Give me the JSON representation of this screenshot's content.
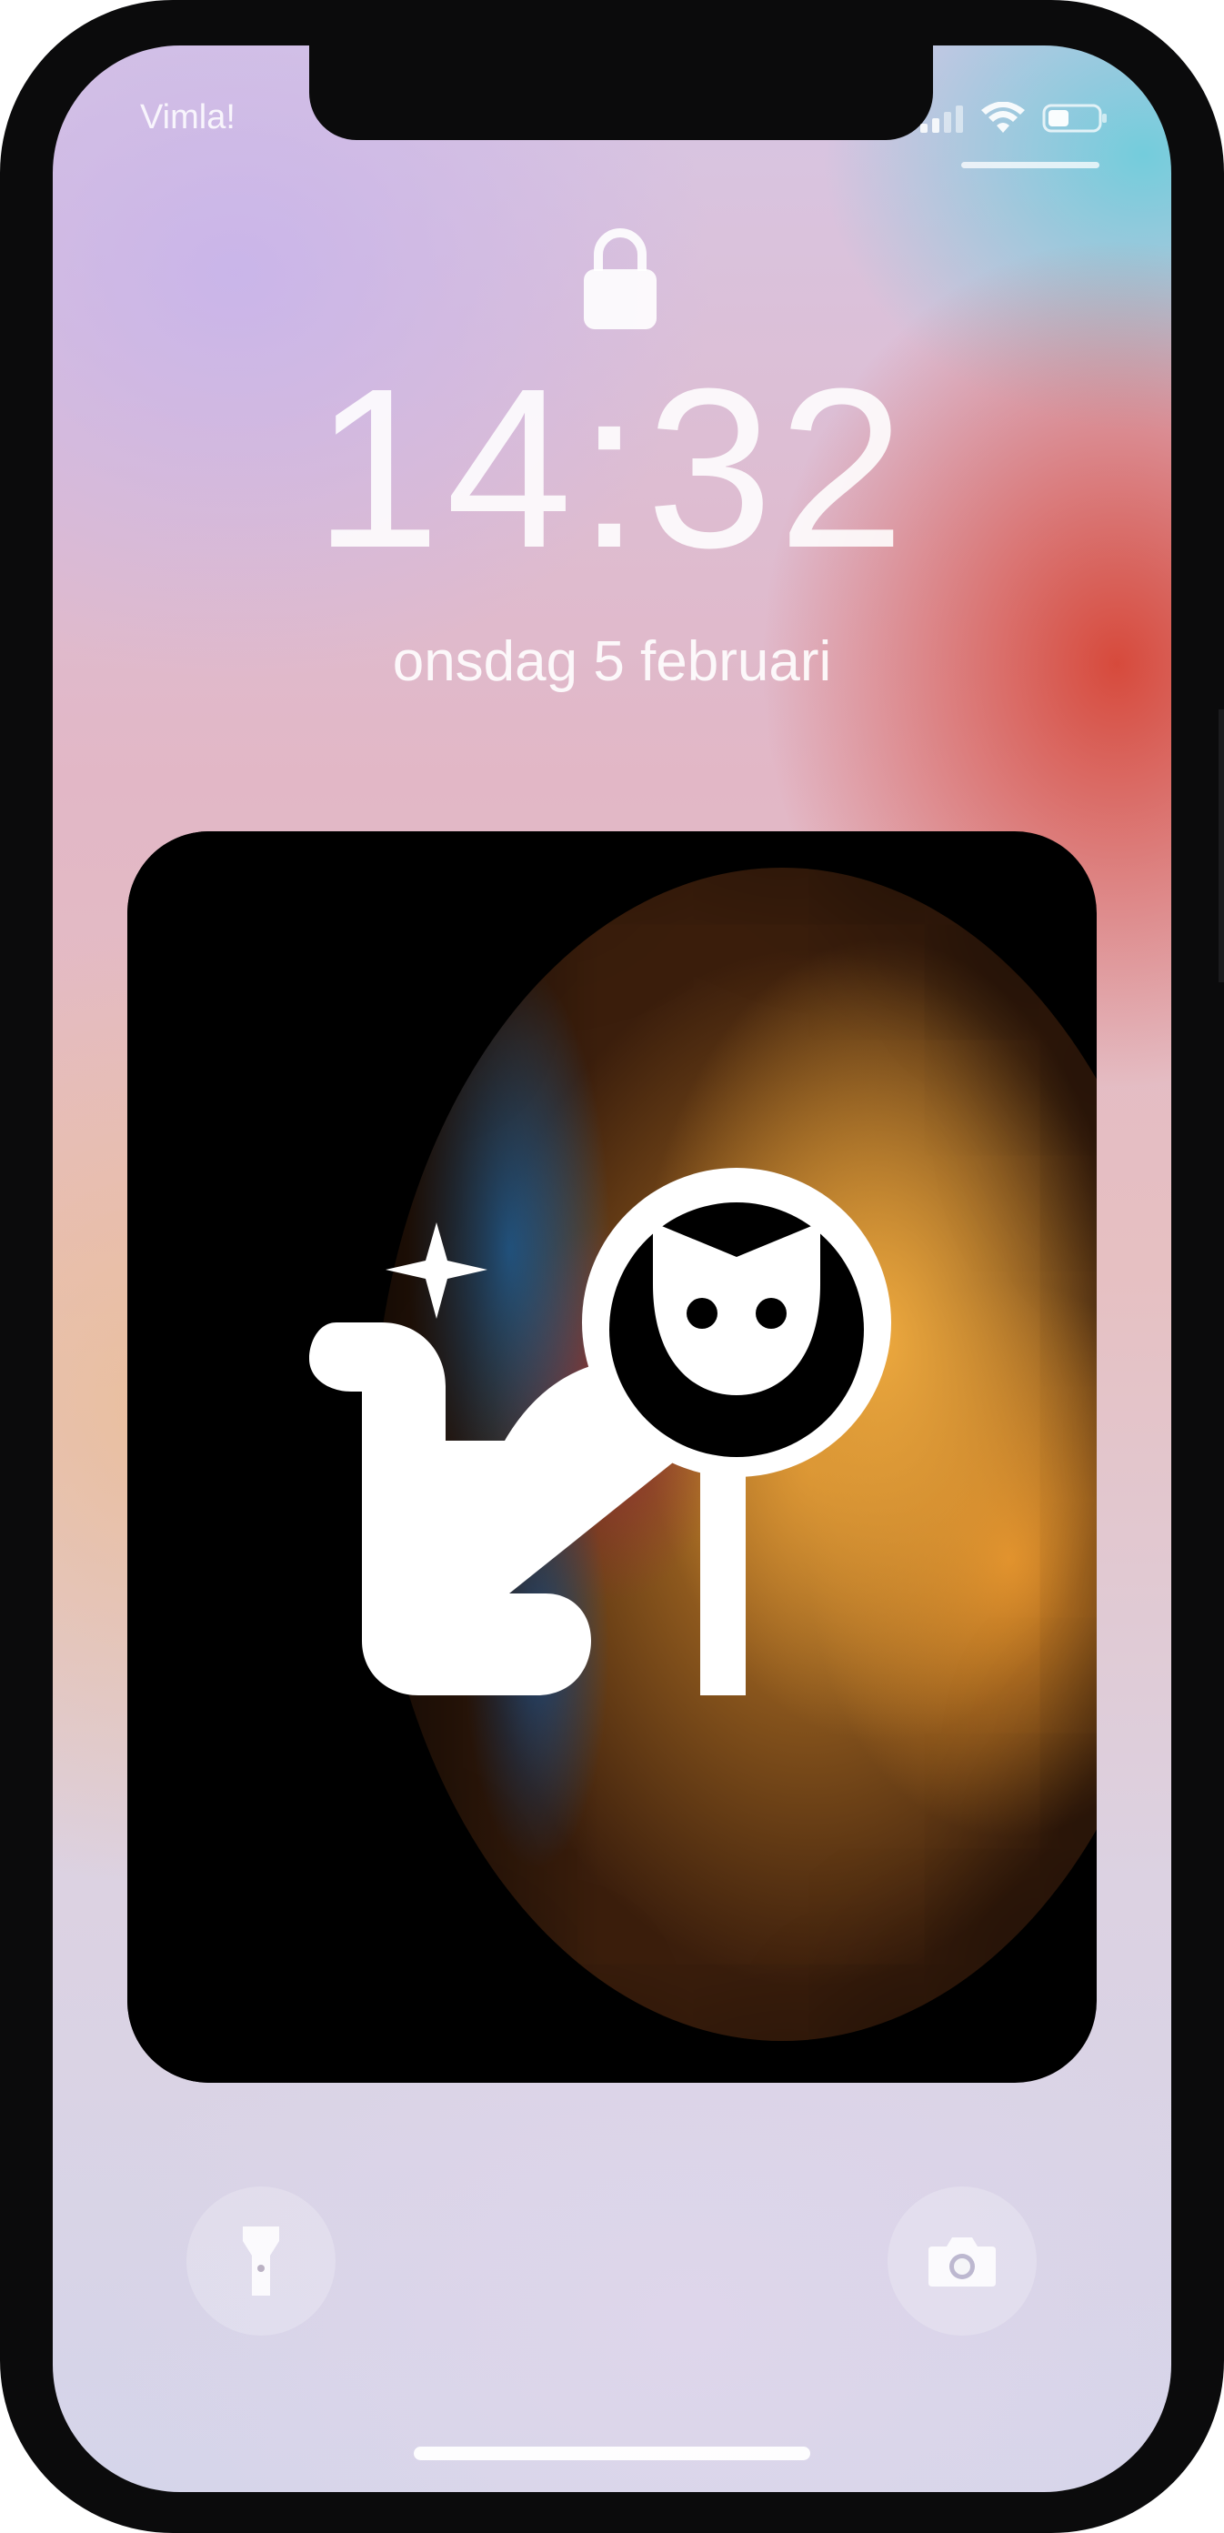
{
  "status_bar": {
    "carrier": "Vimla!",
    "signal_icon": "cellular-signal-icon",
    "wifi_icon": "wifi-icon",
    "battery_icon": "battery-icon"
  },
  "lock_screen": {
    "lock_icon": "padlock-icon",
    "time": "14:32",
    "date": "onsdag 5 februari"
  },
  "widget": {
    "icon": "cat-sparkle-icon",
    "background": "colorful-bubble-wallpaper"
  },
  "quick_actions": {
    "flashlight_icon": "flashlight-icon",
    "camera_icon": "camera-icon"
  },
  "colors": {
    "clock_text": "#FFFFFF",
    "widget_background": "#000000",
    "phone_frame": "#0B0B0C"
  }
}
